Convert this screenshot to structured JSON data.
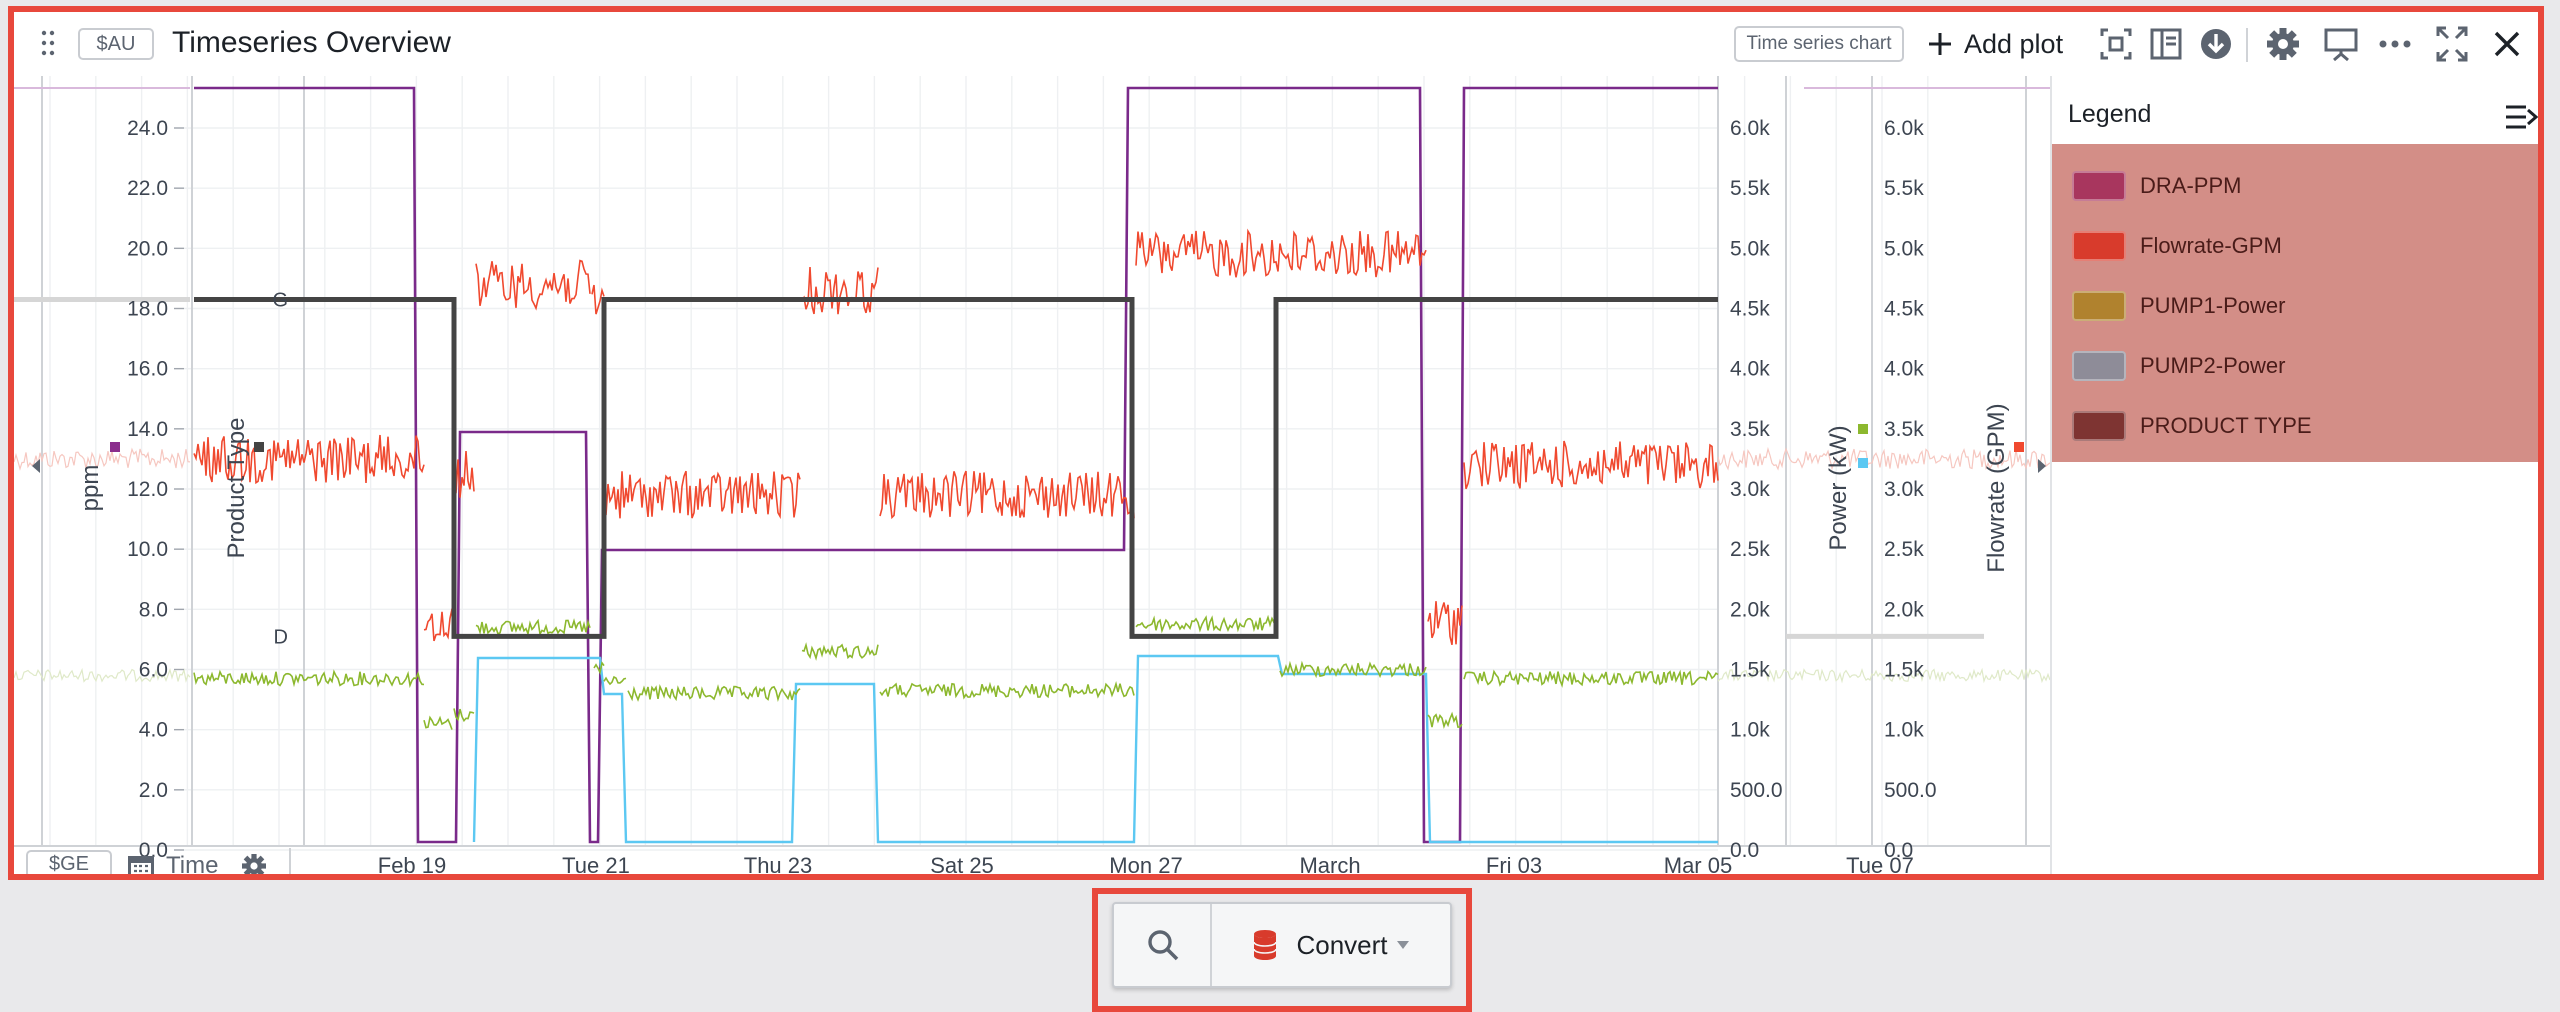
{
  "header": {
    "tag": "$AU",
    "title": "Timeseries Overview",
    "chart_type_label": "Time series chart",
    "add_plot_label": "Add plot"
  },
  "plot": {
    "left_axis_title": "ppm",
    "product_axis_title": "Product Type",
    "right_axis1_title": "Power (kW)",
    "right_axis2_title": "Flowrate (GPM)",
    "ppm_ticks": [
      "24.0",
      "22.0",
      "20.0",
      "18.0",
      "16.0",
      "14.0",
      "12.0",
      "10.0",
      "8.0",
      "6.0",
      "4.0",
      "2.0",
      "0.0"
    ],
    "product_ticks": [
      "G",
      "D"
    ],
    "power_ticks": [
      "6.0k",
      "5.5k",
      "5.0k",
      "4.5k",
      "4.0k",
      "3.5k",
      "3.0k",
      "2.5k",
      "2.0k",
      "1.5k",
      "1.0k",
      "500.0",
      "0.0"
    ],
    "flow_ticks": [
      "6.0k",
      "5.5k",
      "5.0k",
      "4.5k",
      "4.0k",
      "3.5k",
      "3.0k",
      "2.5k",
      "2.0k",
      "1.5k",
      "1.0k",
      "500.0",
      "0.0"
    ],
    "time_ticks": [
      "Feb 19",
      "Tue 21",
      "Thu 23",
      "Sat 25",
      "Mon 27",
      "March",
      "Fri 03",
      "Mar 05",
      "Tue 07"
    ],
    "bottom_tag": "$GE",
    "time_label": "Time"
  },
  "legend": {
    "title": "Legend",
    "items": [
      {
        "label": "DRA-PPM",
        "color": "#a8365e"
      },
      {
        "label": "Flowrate-GPM",
        "color": "#d83b2c"
      },
      {
        "label": "PUMP1-Power",
        "color": "#b0822e"
      },
      {
        "label": "PUMP2-Power",
        "color": "#8e8c98"
      },
      {
        "label": "PRODUCT TYPE",
        "color": "#7e3432"
      }
    ]
  },
  "toolbar": {
    "convert_label": "Convert"
  },
  "colors": {
    "accent_border": "#e8483c",
    "flowrate": "#f0492f",
    "dra_ppm": "#7a2a8a",
    "pump1": "#8cb82e",
    "pump2": "#5cc8f2",
    "product": "#444444"
  }
}
